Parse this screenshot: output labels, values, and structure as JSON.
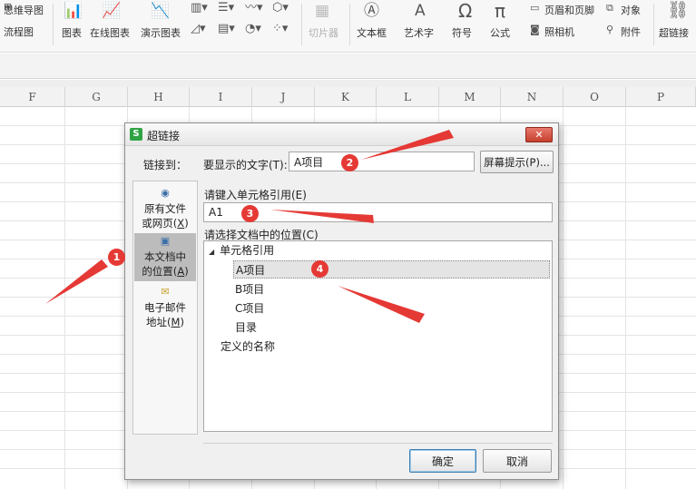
{
  "ribbon": {
    "mindmap_label": "思维导图",
    "flowchart_label": "流程图",
    "chart_label": "图表",
    "online_chart_label": "在线图表",
    "demo_chart_label": "演示图表",
    "slicer_label": "切片器",
    "textbox_label": "文本框",
    "wordart_label": "艺术字",
    "symbol_label": "符号",
    "formula_label": "公式",
    "header_footer_label": "页眉和页脚",
    "object_label": "对象",
    "camera_label": "照相机",
    "attachment_label": "附件",
    "hyperlink_label": "超链接"
  },
  "columns": [
    "F",
    "G",
    "H",
    "I",
    "J",
    "K",
    "L",
    "M",
    "N",
    "O",
    "P"
  ],
  "dialog": {
    "title": "超链接",
    "close_glyph": "✕",
    "link_to_label": "链接到：",
    "display_text_label": "要显示的文字(T):",
    "display_text_value": "A项目",
    "screen_tip_button": "屏幕提示(P)...",
    "cell_ref_label": "请键入单元格引用(E)",
    "cell_ref_value": "A1",
    "location_label": "请选择文档中的位置(C)",
    "link_types": [
      {
        "line1": "原有文件",
        "line2_pre": "或网页(",
        "key": "X",
        "line2_post": ")"
      },
      {
        "line1": "本文档中",
        "line2_pre": "的位置(",
        "key": "A",
        "line2_post": ")"
      },
      {
        "line1": "电子邮件",
        "line2_pre": "地址(",
        "key": "M",
        "line2_post": ")"
      }
    ],
    "tree": {
      "group1": "单元格引用",
      "items": [
        "A项目",
        "B项目",
        "C项目",
        "目录"
      ],
      "group2": "定义的名称"
    },
    "ok_button": "确定",
    "cancel_button": "取消"
  },
  "annotations": [
    "1",
    "2",
    "3",
    "4"
  ],
  "colors": {
    "annotation_red": "#e53935",
    "app_green": "#2fa344",
    "close_red": "#c6402e"
  }
}
